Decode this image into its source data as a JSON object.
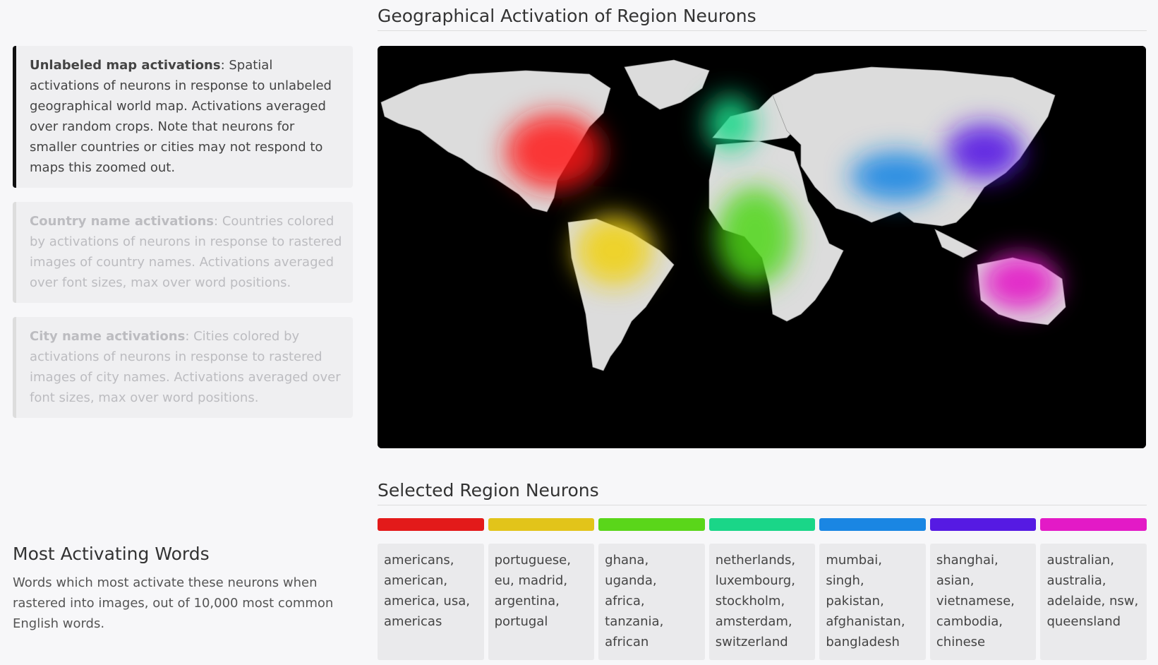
{
  "map": {
    "title": "Geographical Activation of Region Neurons"
  },
  "cards": [
    {
      "title": "Unlabeled map activations",
      "text": ": Spatial activations of neurons in response to unlabeled geographical world map. Activations averaged over random crops. Note that neurons for smaller countries or cities may not respond to maps this zoomed out."
    },
    {
      "title": "Country name activations",
      "text": ": Countries colored by activations of neurons in response to rastered images of country names. Activations averaged over font sizes, max over word positions."
    },
    {
      "title": "City name activations",
      "text": ": Cities colored by activations of neurons in response to rastered images of city names. Activations averaged over font sizes, max over word positions."
    }
  ],
  "words_section": {
    "title": "Most Activating Words",
    "description": "Words which most activate these neurons when rastered into images, out of 10,000 most common English words."
  },
  "selected": {
    "title": "Selected Region Neurons",
    "neurons": [
      {
        "color": "#e31a1a",
        "words": "americans, american, america, usa, americas"
      },
      {
        "color": "#e2c41a",
        "words": "portuguese, eu, madrid, argentina, portugal"
      },
      {
        "color": "#5ad61a",
        "words": "ghana, uganda, africa, tanzania, african"
      },
      {
        "color": "#1ad688",
        "words": "netherlands, luxembourg, stockholm, amsterdam, switzerland"
      },
      {
        "color": "#1a86e3",
        "words": "mumbai, singh, pakistan, afghanistan, bangladesh"
      },
      {
        "color": "#561ae3",
        "words": "shanghai, asian, vietnamese, cambodia, chinese"
      },
      {
        "color": "#e31ac6",
        "words": "australian, australia, adelaide, nsw, queensland"
      }
    ]
  }
}
